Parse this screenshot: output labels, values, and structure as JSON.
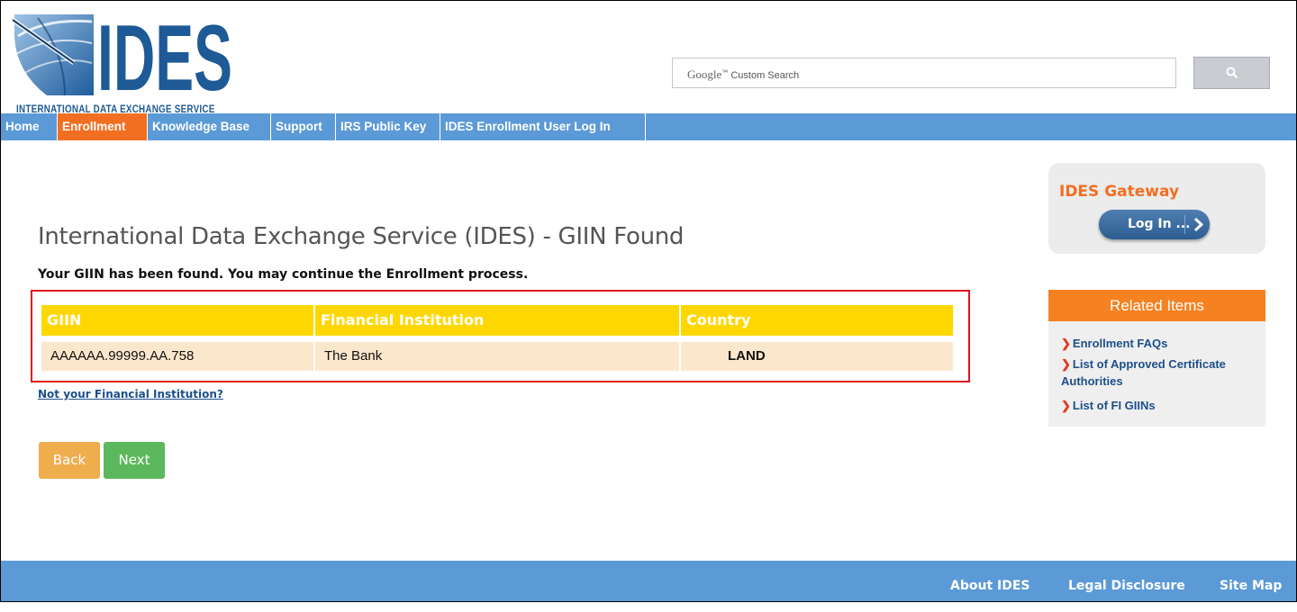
{
  "logo": {
    "title": "IDES",
    "subtitle": "INTERNATIONAL DATA EXCHANGE SERVICE"
  },
  "search": {
    "brand": "Google",
    "tm": "™",
    "placeholder": "Custom Search",
    "button_icon": "search-icon"
  },
  "nav": {
    "items": [
      {
        "label": "Home",
        "active": false
      },
      {
        "label": "Enrollment",
        "active": true
      },
      {
        "label": "Knowledge Base",
        "active": false
      },
      {
        "label": "Support",
        "active": false
      },
      {
        "label": "IRS Public Key",
        "active": false
      },
      {
        "label": "IDES Enrollment User Log In",
        "active": false
      }
    ]
  },
  "main": {
    "title": "International Data Exchange Service (IDES) - GIIN Found",
    "message": "Your GIIN has been found. You may continue the Enrollment process.",
    "table": {
      "headers": [
        "GIIN",
        "Financial Institution",
        "Country"
      ],
      "row": [
        "AAAAAA.99999.AA.758",
        "The Bank",
        "LAND"
      ]
    },
    "not_fi_link": "Not your Financial Institution?",
    "back_label": "Back",
    "next_label": "Next"
  },
  "gateway": {
    "title": "IDES Gateway",
    "login_label": "Log In ..."
  },
  "related": {
    "title": "Related Items",
    "items": [
      "Enrollment FAQs",
      "List of Approved Certificate Authorities",
      "List of FI GIINs"
    ]
  },
  "footer": {
    "links": [
      "About IDES",
      "Legal Disclosure",
      "Site Map"
    ]
  },
  "colors": {
    "nav": "#5b9ad6",
    "active": "#f26f21",
    "header_yellow": "#ffd700",
    "row_bg": "#fbe7cc",
    "highlight": "#e0141e"
  }
}
